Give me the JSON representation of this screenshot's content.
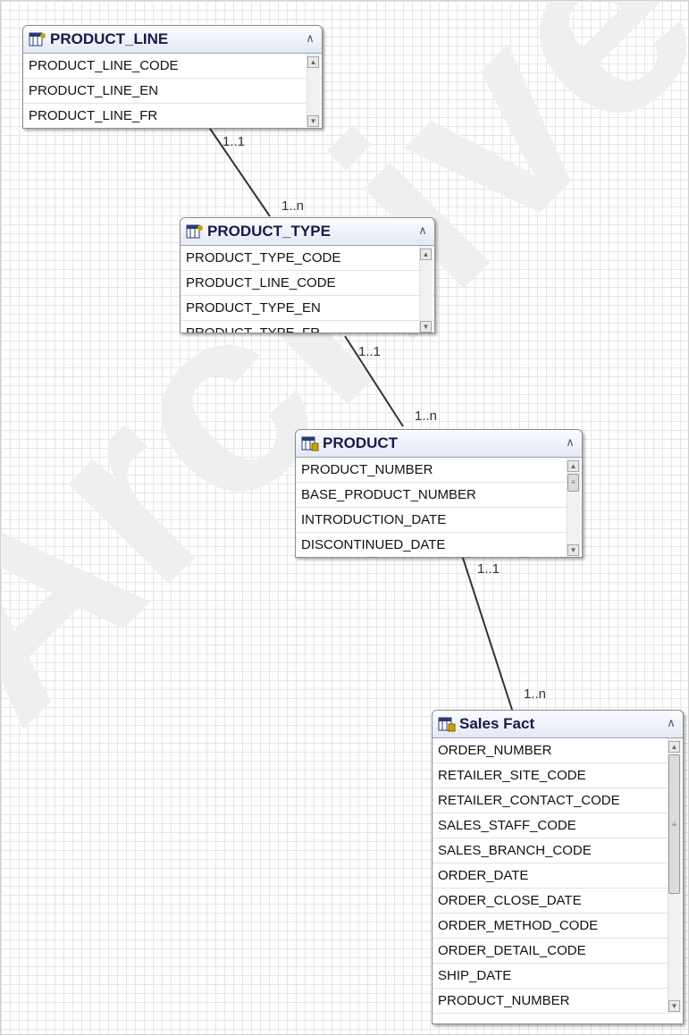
{
  "entities": {
    "product_line": {
      "title": "PRODUCT_LINE",
      "fields": [
        "PRODUCT_LINE_CODE",
        "PRODUCT_LINE_EN",
        "PRODUCT_LINE_FR"
      ]
    },
    "product_type": {
      "title": "PRODUCT_TYPE",
      "fields": [
        "PRODUCT_TYPE_CODE",
        "PRODUCT_LINE_CODE",
        "PRODUCT_TYPE_EN",
        "PRODUCT_TYPE_FR"
      ]
    },
    "product": {
      "title": "PRODUCT",
      "fields": [
        "PRODUCT_NUMBER",
        "BASE_PRODUCT_NUMBER",
        "INTRODUCTION_DATE",
        "DISCONTINUED_DATE"
      ]
    },
    "sales_fact": {
      "title": "Sales Fact",
      "fields": [
        "ORDER_NUMBER",
        "RETAILER_SITE_CODE",
        "RETAILER_CONTACT_CODE",
        "SALES_STAFF_CODE",
        "SALES_BRANCH_CODE",
        "ORDER_DATE",
        "ORDER_CLOSE_DATE",
        "ORDER_METHOD_CODE",
        "ORDER_DETAIL_CODE",
        "SHIP_DATE",
        "PRODUCT_NUMBER"
      ]
    }
  },
  "relationships": [
    {
      "from": "PRODUCT_LINE",
      "to": "PRODUCT_TYPE",
      "from_card": "1..1",
      "to_card": "1..n"
    },
    {
      "from": "PRODUCT_TYPE",
      "to": "PRODUCT",
      "from_card": "1..1",
      "to_card": "1..n"
    },
    {
      "from": "PRODUCT",
      "to": "Sales Fact",
      "from_card": "1..1",
      "to_card": "1..n"
    }
  ],
  "icons": {
    "entity_icon": "table-icon",
    "fact_icon": "fact-table-icon",
    "collapse_icon": "collapse-icon"
  },
  "watermark": "Archived",
  "colors": {
    "header_text": "#1a1a4a",
    "link": "#333333"
  }
}
